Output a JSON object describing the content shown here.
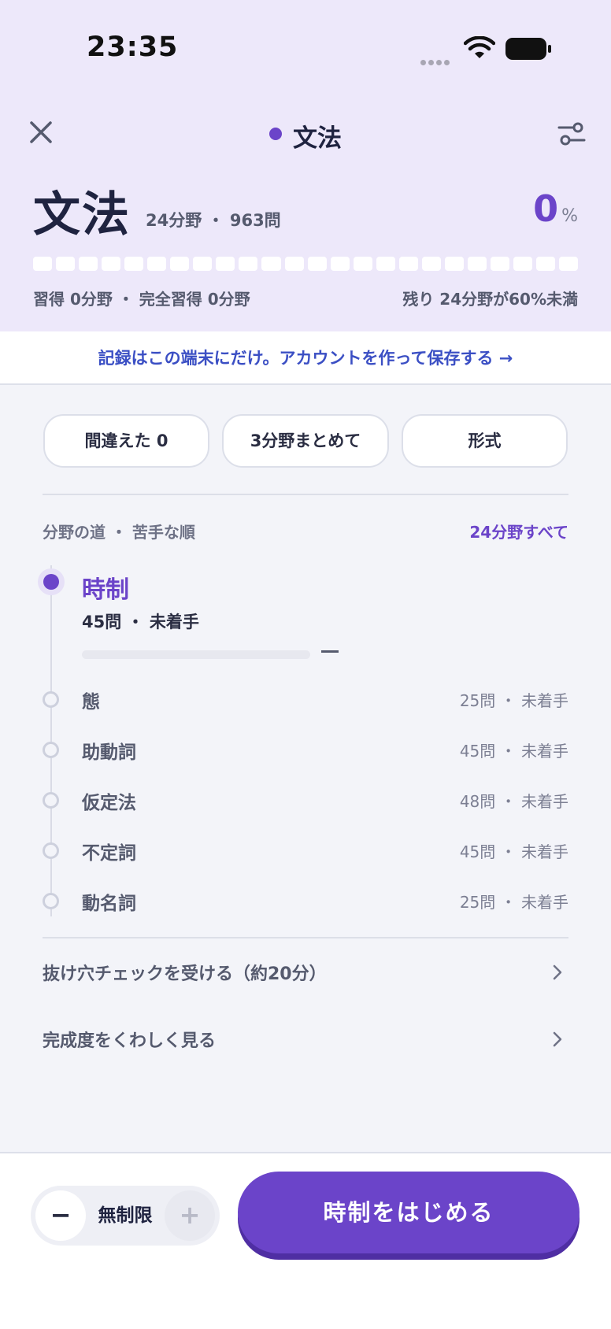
{
  "status_bar": {
    "time": "23:35"
  },
  "nav": {
    "title": "文法",
    "accent_color": "#6b44c9"
  },
  "header": {
    "subject": "文法",
    "meta": "24分野 ・ 963問",
    "percent": "0",
    "percent_unit": "%",
    "segments_total": 24,
    "segments_filled": 0,
    "stat_left": "習得 0分野 ・ 完全習得 0分野",
    "stat_right": "残り 24分野が60%未満"
  },
  "banner": {
    "text": "記録はこの端末にだけ。アカウントを作って保存する →"
  },
  "chips": [
    "間違えた 0",
    "3分野まとめて",
    "形式"
  ],
  "path": {
    "label": "分野の道 ・ 苦手な順",
    "all_link": "24分野すべて",
    "active": {
      "name": "時制",
      "meta": "45問 ・ 未着手",
      "progress": 0,
      "progress_text": "—"
    },
    "topics": [
      {
        "name": "態",
        "meta": "25問 ・ 未着手"
      },
      {
        "name": "助動詞",
        "meta": "45問 ・ 未着手"
      },
      {
        "name": "仮定法",
        "meta": "48問 ・ 未着手"
      },
      {
        "name": "不定詞",
        "meta": "45問 ・ 未着手"
      },
      {
        "name": "動名詞",
        "meta": "25問 ・ 未着手"
      }
    ]
  },
  "links": [
    {
      "text": "抜け穴チェックを受ける（約20分）"
    },
    {
      "text": "完成度をくわしく見る"
    }
  ],
  "footer": {
    "stepper_minus": "−",
    "stepper_value": "無制限",
    "stepper_plus": "+",
    "start_label": "時制をはじめる"
  }
}
